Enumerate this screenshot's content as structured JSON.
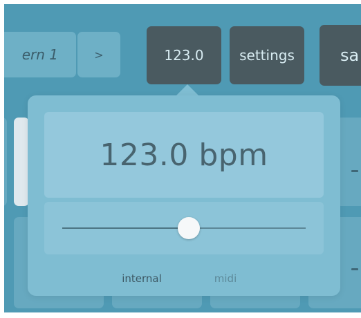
{
  "toolbar": {
    "pattern_label": "ern 1",
    "next_label": ">",
    "tempo_label": "123.0",
    "settings_label": "settings",
    "save_label": "sa"
  },
  "tempo_popover": {
    "bpm_display": "123.0 bpm",
    "slider_level": 0.52,
    "modes": {
      "internal": "internal",
      "midi": "midi"
    },
    "selected_mode": "internal"
  },
  "colors": {
    "background": "#4f9ab4",
    "popover": "#7fbdd2",
    "dark_button": "#4a5a60",
    "text_dark": "#48646f"
  }
}
